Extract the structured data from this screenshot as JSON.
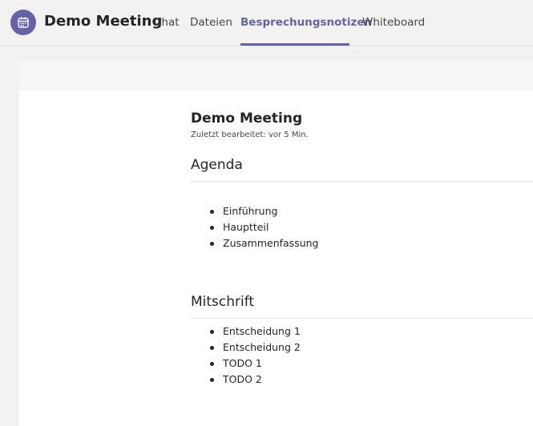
{
  "header": {
    "app_icon": "calendar-icon",
    "meeting_title": "Demo Meeting",
    "tabs": [
      {
        "label": "Chat",
        "active": false
      },
      {
        "label": "Dateien",
        "active": false
      },
      {
        "label": "Besprechungsnotizen",
        "active": true
      },
      {
        "label": "Whiteboard",
        "active": false
      }
    ]
  },
  "colors": {
    "accent": "#6264a7",
    "background": "#f3f2f1",
    "text": "#252423"
  },
  "document": {
    "title": "Demo Meeting",
    "last_edited": "Zuletzt bearbeitet: vor 5 Min.",
    "sections": [
      {
        "heading": "Agenda",
        "items": [
          "Einführung",
          "Hauptteil",
          "Zusammenfassung"
        ]
      },
      {
        "heading": "Mitschrift",
        "items": [
          "Entscheidung 1",
          "Entscheidung 2",
          "TODO 1",
          "TODO 2"
        ]
      }
    ]
  }
}
